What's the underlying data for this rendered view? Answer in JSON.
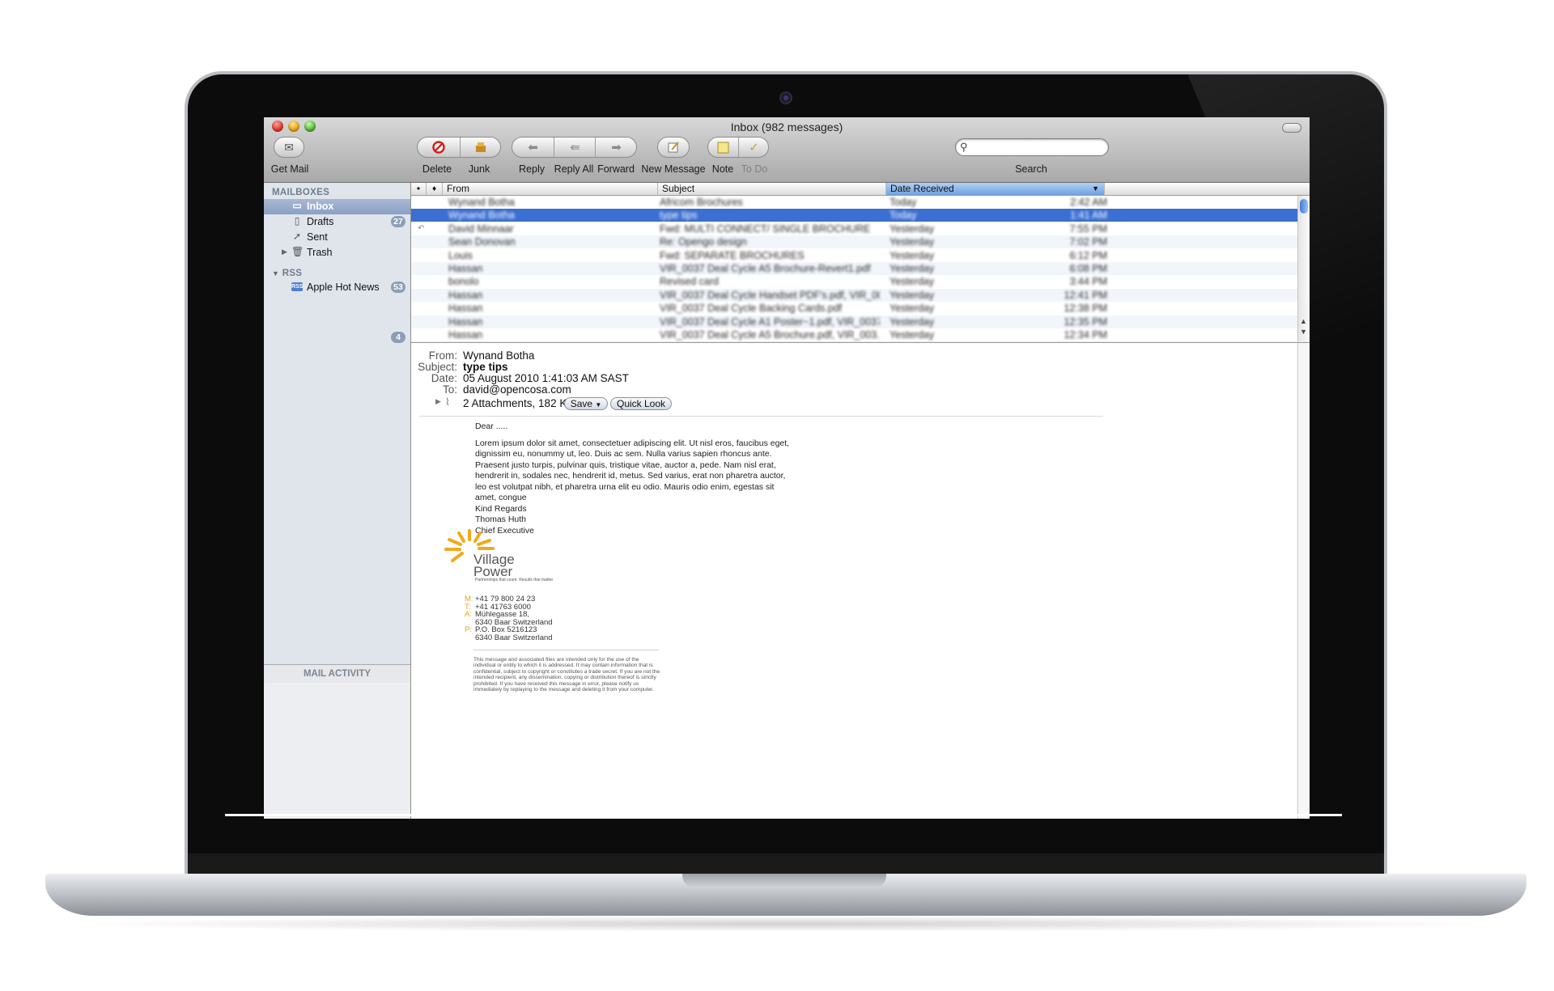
{
  "window": {
    "title": "Inbox (982 messages)"
  },
  "toolbar": {
    "get_mail": "Get Mail",
    "delete": "Delete",
    "junk": "Junk",
    "reply": "Reply",
    "reply_all": "Reply All",
    "forward": "Forward",
    "new_message": "New Message",
    "note": "Note",
    "todo": "To Do",
    "search_label": "Search",
    "search_placeholder": ""
  },
  "sidebar": {
    "mailboxes_heading": "MAILBOXES",
    "rss_heading": "RSS",
    "items": [
      {
        "label": "Inbox",
        "badge": "",
        "icon": "inbox-icon"
      },
      {
        "label": "Drafts",
        "badge": "27",
        "icon": "drafts-icon"
      },
      {
        "label": "Sent",
        "badge": "",
        "icon": "sent-icon"
      },
      {
        "label": "Trash",
        "badge": "",
        "icon": "trash-icon"
      }
    ],
    "rss_items": [
      {
        "label": "Apple Hot News",
        "badge": "53",
        "icon": "rss-icon"
      }
    ],
    "extra_badge": "4",
    "activity_label": "MAIL ACTIVITY"
  },
  "list": {
    "columns": {
      "from": "From",
      "subject": "Subject",
      "date": "Date Received"
    },
    "rows": [
      {
        "from": "Wynand Botha",
        "subject": "Africom Brochures",
        "date": "Today",
        "time": "2:42 AM",
        "selected": false
      },
      {
        "from": "Wynand Botha",
        "subject": "type tips",
        "date": "Today",
        "time": "1:41 AM",
        "selected": true
      },
      {
        "from": "David Minnaar",
        "subject": "Fwd: MULTI CONNECT/ SINGLE BROCHURE",
        "date": "Yesterday",
        "time": "7:55 PM",
        "selected": false
      },
      {
        "from": "Sean Donovan",
        "subject": "Re: Opengo design",
        "date": "Yesterday",
        "time": "7:02 PM",
        "selected": false
      },
      {
        "from": "Louis",
        "subject": "Fwd: SEPARATE BROCHURES",
        "date": "Yesterday",
        "time": "6:12 PM",
        "selected": false
      },
      {
        "from": "Hassan",
        "subject": "VIR_0037 Deal Cycle A5 Brochure-Revert1.pdf",
        "date": "Yesterday",
        "time": "6:08 PM",
        "selected": false
      },
      {
        "from": "bonolo",
        "subject": "Revised card",
        "date": "Yesterday",
        "time": "3:44 PM",
        "selected": false
      },
      {
        "from": "Hassan",
        "subject": "VIR_0037 Deal Cycle Handset PDF's.pdf, VIR_00...",
        "date": "Yesterday",
        "time": "12:41 PM",
        "selected": false
      },
      {
        "from": "Hassan",
        "subject": "VIR_0037 Deal Cycle Backing Cards.pdf",
        "date": "Yesterday",
        "time": "12:38 PM",
        "selected": false
      },
      {
        "from": "Hassan",
        "subject": "VIR_0037 Deal Cycle A1 Poster~1.pdf, VIR_0037...",
        "date": "Yesterday",
        "time": "12:35 PM",
        "selected": false
      },
      {
        "from": "Hassan",
        "subject": "VIR_0037 Deal Cycle A5 Brochure.pdf, VIR_003...",
        "date": "Yesterday",
        "time": "12:34 PM",
        "selected": false
      }
    ]
  },
  "message": {
    "from_key": "From:",
    "from": "Wynand Botha",
    "subject_key": "Subject:",
    "subject": "type tips",
    "date_key": "Date:",
    "date": "05 August 2010 1:41:03 AM SAST",
    "to_key": "To:",
    "to": "david@opencosa.com",
    "attachments": "2 Attachments, 182 KB",
    "save_label": "Save",
    "quicklook_label": "Quick Look",
    "greeting": "Dear .....",
    "body_lines": [
      "Lorem ipsum dolor sit amet, consectetuer adipiscing elit. Ut nisl eros, faucibus eget,",
      "dignissim eu, nonummy ut, leo. Duis ac sem. Nulla varius sapien rhoncus ante.",
      "Praesent justo turpis, pulvinar quis, tristique vitae, auctor a, pede. Nam nisl erat,",
      "hendrerit in, sodales nec, hendrerit id, metus. Sed varius, erat non pharetra auctor,",
      "leo est volutpat nibh, et pharetra urna elit eu odio. Mauris odio enim, egestas sit",
      "amet, congue"
    ],
    "signoff": "Kind Regards",
    "sender_name": "Thomas Huth",
    "sender_title": "Chief Executive",
    "logo_line1": "Village",
    "logo_line2": "Power",
    "logo_tagline": "Partnerships that count. Results that matter.",
    "contact": [
      {
        "key": "M:",
        "lines": [
          "+41 79 800 24 23"
        ]
      },
      {
        "key": "T:",
        "lines": [
          "+41 41763 6000"
        ]
      },
      {
        "key": "A:",
        "lines": [
          "Mühlegasse 18,",
          "6340 Baar Switzerland"
        ]
      },
      {
        "key": "P:",
        "lines": [
          "P.O. Box 5216123",
          "6340 Baar Switzerland"
        ]
      }
    ],
    "disclaimer": "This message and associated files are intended only for the use of the individual or entity to which it is addressed. It may contain information that is confidential, subject to copyright or constitutes a trade secret. If you are not the intended recipient, any dissemination, copying or distribution thereof is strictly prohibited. If you have received this message in error, please notify us immediately by replaying to the message and deleting it from your computer."
  },
  "colors": {
    "selection": "#3b6fd2",
    "sidebar": "#e0e5ec",
    "logo_accent": "#f2a91a"
  }
}
